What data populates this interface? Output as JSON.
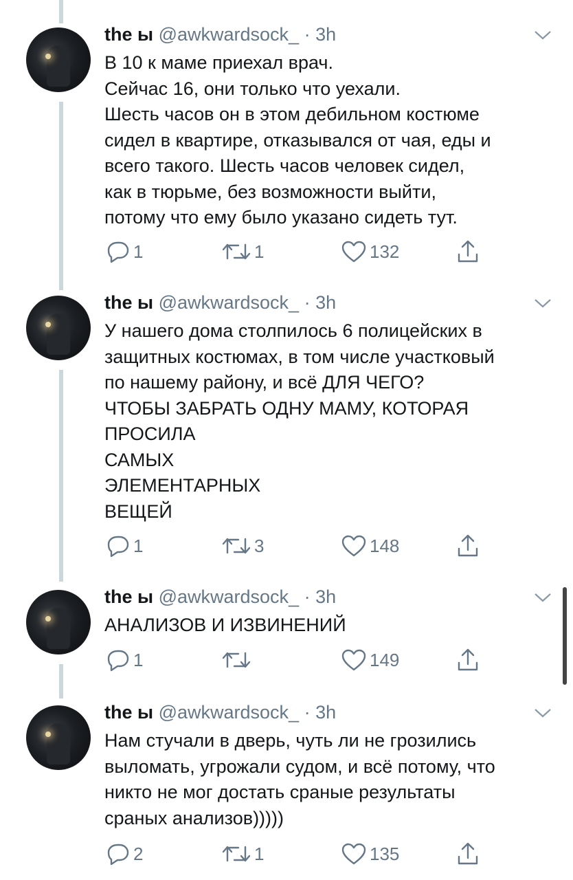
{
  "tweets": [
    {
      "name": "the ы",
      "handle": "@awkwardsock_",
      "separator": "·",
      "time": "3h",
      "text": "В 10 к маме приехал врач.\nСейчас 16, они только что уехали.\nШесть часов он в этом дебильном костюме\nсидел в квартире, отказывался от чая, еды и\nвсего такого. Шесть часов человек сидел,\nкак в тюрьме, без возможности выйти,\nпотому что ему было указано сидеть тут.",
      "replies": "1",
      "retweets": "1",
      "likes": "132"
    },
    {
      "name": "the ы",
      "handle": "@awkwardsock_",
      "separator": "·",
      "time": "3h",
      "text": "У нашего дома столпилось 6 полицейских в\nзащитных костюмах, в том числе участковый\nпо нашему району, и всё ДЛЯ ЧЕГО?\nЧТОБЫ ЗАБРАТЬ ОДНУ МАМУ, КОТОРАЯ\nПРОСИЛА\nСАМЫХ\nЭЛЕМЕНТАРНЫХ\nВЕЩЕЙ",
      "replies": "1",
      "retweets": "3",
      "likes": "148"
    },
    {
      "name": "the ы",
      "handle": "@awkwardsock_",
      "separator": "·",
      "time": "3h",
      "text": "АНАЛИЗОВ И ИЗВИНЕНИЙ",
      "replies": "1",
      "retweets": "",
      "likes": "149"
    },
    {
      "name": "the ы",
      "handle": "@awkwardsock_",
      "separator": "·",
      "time": "3h",
      "text": "Нам стучали в дверь, чуть ли не грозились\nвыломать, угрожали судом, и всё потому, что\nникто не мог достать сраные результаты\nсраных анализов)))))",
      "replies": "2",
      "retweets": "1",
      "likes": "135"
    }
  ],
  "icons": {
    "reply": "reply-icon",
    "retweet": "retweet-icon",
    "like": "heart-icon",
    "share": "share-icon",
    "more": "chevron-down-icon"
  },
  "colors": {
    "text": "#14171a",
    "secondary": "#657786",
    "thread_line": "#ccd6dd",
    "background": "#ffffff"
  }
}
